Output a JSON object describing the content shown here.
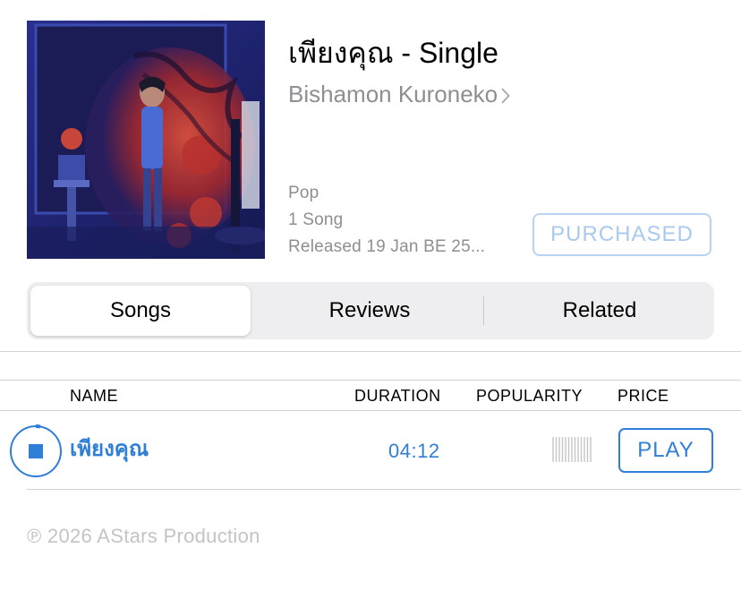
{
  "album": {
    "title": "เพียงคุณ - Single",
    "artist": "Bishamon Kuroneko",
    "genre": "Pop",
    "song_count": "1 Song",
    "released": "Released 19 Jan BE 25...",
    "purchased_label": "PURCHASED",
    "artwork_icon": "album-artwork"
  },
  "tabs": [
    {
      "label": "Songs",
      "selected": true
    },
    {
      "label": "Reviews",
      "selected": false
    },
    {
      "label": "Related",
      "selected": false
    }
  ],
  "table": {
    "columns": [
      "NAME",
      "DURATION",
      "POPULARITY",
      "PRICE"
    ],
    "rows": [
      {
        "name": "เพียงคุณ",
        "duration": "04:12",
        "popularity_icon": "popularity-bars",
        "price_label": "PLAY",
        "state_icon": "stop-icon"
      }
    ]
  },
  "footer": {
    "copyright": "℗ 2026 AStars Production"
  },
  "colors": {
    "accent": "#2f7ed8",
    "purchased": "#a9c9ef",
    "secondary_text": "#8e8e93"
  }
}
